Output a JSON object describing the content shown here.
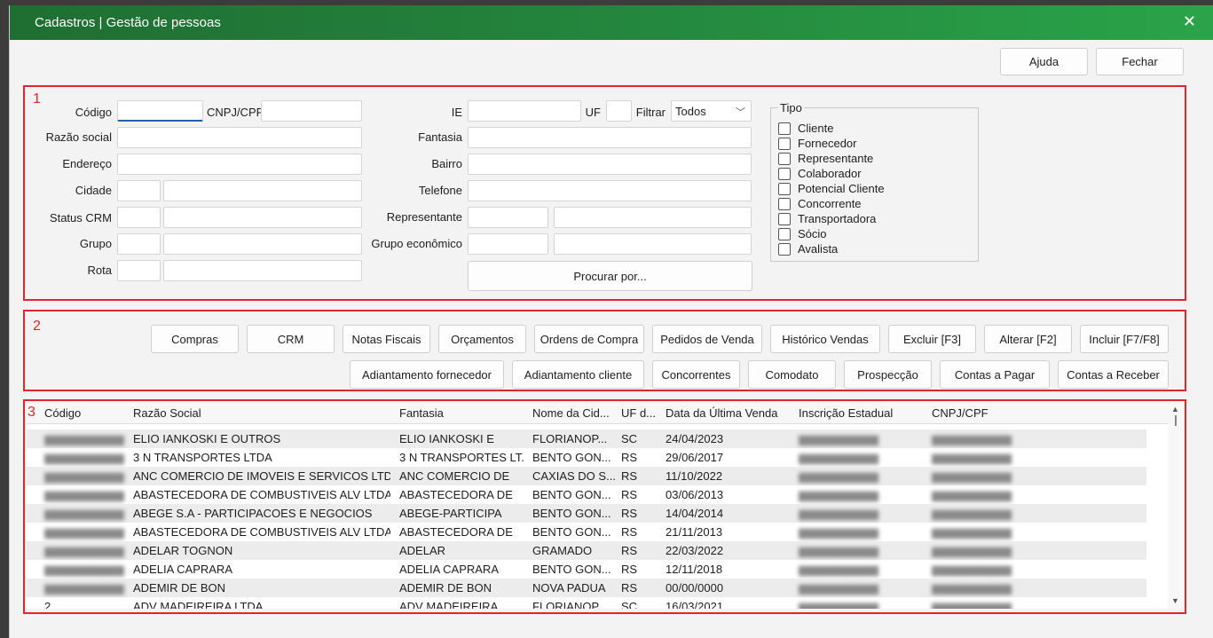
{
  "window": {
    "title": "Cadastros | Gestão de pessoas"
  },
  "toolbar": {
    "ajuda": "Ajuda",
    "fechar": "Fechar"
  },
  "regions": [
    "1",
    "2",
    "3"
  ],
  "form": {
    "codigo": "Código",
    "cnpj_cpf": "CNPJ/CPF",
    "ie": "IE",
    "uf": "UF",
    "filtrar": "Filtrar",
    "filtrar_value": "Todos",
    "razao_social": "Razão social",
    "fantasia": "Fantasia",
    "endereco": "Endereço",
    "bairro": "Bairro",
    "cidade": "Cidade",
    "telefone": "Telefone",
    "status_crm": "Status CRM",
    "representante": "Representante",
    "grupo": "Grupo",
    "grupo_economico": "Grupo econômico",
    "rota": "Rota",
    "procurar": "Procurar por..."
  },
  "tipo": {
    "legend": "Tipo",
    "options": [
      "Cliente",
      "Fornecedor",
      "Representante",
      "Colaborador",
      "Potencial Cliente",
      "Concorrente",
      "Transportadora",
      "Sócio",
      "Avalista"
    ]
  },
  "actions_row1": [
    "Compras",
    "CRM",
    "Notas Fiscais",
    "Orçamentos",
    "Ordens de Compra",
    "Pedidos de Venda",
    "Histórico Vendas",
    "Excluir [F3]",
    "Alterar [F2]",
    "Incluir [F7/F8]"
  ],
  "actions_row2": [
    "Adiantamento fornecedor",
    "Adiantamento cliente",
    "Concorrentes",
    "Comodato",
    "Prospecção",
    "Contas a Pagar",
    "Contas a Receber"
  ],
  "grid": {
    "columns": [
      "Código",
      "Razão Social",
      "Fantasia",
      "Nome da Cid...",
      "UF d...",
      "Data da Última Venda",
      "Inscrição Estadual",
      "CNPJ/CPF"
    ],
    "rows": [
      {
        "codigo": "",
        "razao": "ELIO IANKOSKI E OUTROS",
        "fantasia": "ELIO IANKOSKI E",
        "cidade": "FLORIANOP...",
        "uf": "SC",
        "data": "24/04/2023",
        "ie": "",
        "cnpj": ""
      },
      {
        "codigo": "",
        "razao": "3 N TRANSPORTES LTDA",
        "fantasia": "3 N TRANSPORTES LT...",
        "cidade": "BENTO GON...",
        "uf": "RS",
        "data": "29/06/2017",
        "ie": "",
        "cnpj": ""
      },
      {
        "codigo": "",
        "razao": "ANC COMERCIO DE IMOVEIS E SERVICOS LTDA",
        "fantasia": "ANC COMERCIO DE",
        "cidade": "CAXIAS DO S...",
        "uf": "RS",
        "data": "11/10/2022",
        "ie": "",
        "cnpj": ""
      },
      {
        "codigo": "",
        "razao": "ABASTECEDORA DE COMBUSTIVEIS ALV LTDA",
        "fantasia": "ABASTECEDORA DE",
        "cidade": "BENTO GON...",
        "uf": "RS",
        "data": "03/06/2013",
        "ie": "",
        "cnpj": ""
      },
      {
        "codigo": "",
        "razao": "ABEGE S.A - PARTICIPACOES E NEGOCIOS",
        "fantasia": "ABEGE-PARTICIPA",
        "cidade": "BENTO GON...",
        "uf": "RS",
        "data": "14/04/2014",
        "ie": "",
        "cnpj": ""
      },
      {
        "codigo": "",
        "razao": "ABASTECEDORA DE COMBUSTIVEIS ALV LTDA FI",
        "fantasia": "ABASTECEDORA DE",
        "cidade": "BENTO GON...",
        "uf": "RS",
        "data": "21/11/2013",
        "ie": "",
        "cnpj": ""
      },
      {
        "codigo": "",
        "razao": "ADELAR TOGNON",
        "fantasia": "ADELAR",
        "cidade": "GRAMADO",
        "uf": "RS",
        "data": "22/03/2022",
        "ie": "",
        "cnpj": ""
      },
      {
        "codigo": "",
        "razao": "ADELIA CAPRARA",
        "fantasia": "ADELIA CAPRARA",
        "cidade": "BENTO GON...",
        "uf": "RS",
        "data": "12/11/2018",
        "ie": "",
        "cnpj": ""
      },
      {
        "codigo": "",
        "razao": "ADEMIR DE BON",
        "fantasia": "ADEMIR DE BON",
        "cidade": "NOVA PADUA",
        "uf": "RS",
        "data": "00/00/0000",
        "ie": "",
        "cnpj": ""
      },
      {
        "codigo": "2",
        "razao": "ADV MADEIREIRA LTDA",
        "fantasia": "ADV MADEIREIRA",
        "cidade": "FLORIANOP...",
        "uf": "SC",
        "data": "16/03/2021",
        "ie": "",
        "cnpj": ""
      }
    ]
  }
}
